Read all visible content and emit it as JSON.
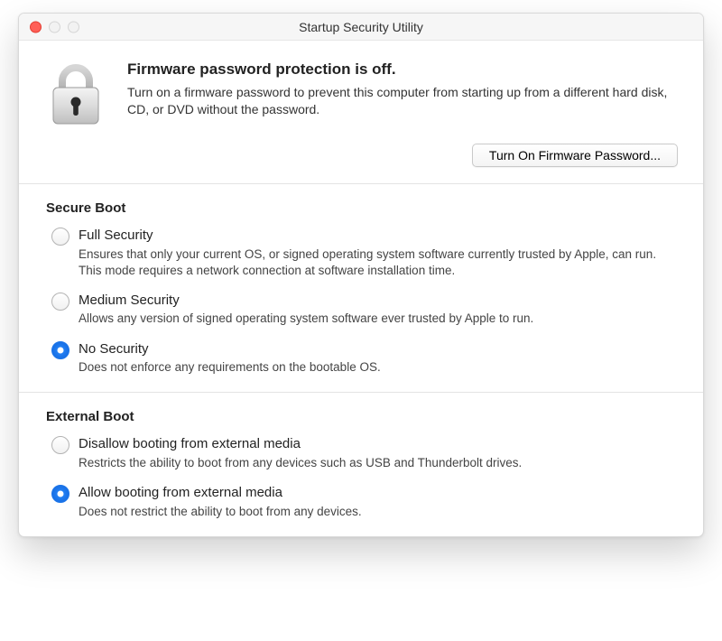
{
  "window": {
    "title": "Startup Security Utility"
  },
  "firmware": {
    "heading": "Firmware password protection is off.",
    "description": "Turn on a firmware password to prevent this computer from starting up from a different hard disk, CD, or DVD without the password.",
    "button_label": "Turn On Firmware Password..."
  },
  "secure_boot": {
    "heading": "Secure Boot",
    "options": [
      {
        "label": "Full Security",
        "description": "Ensures that only your current OS, or signed operating system software currently trusted by Apple, can run. This mode requires a network connection at software installation time.",
        "selected": false
      },
      {
        "label": "Medium Security",
        "description": "Allows any version of signed operating system software ever trusted by Apple to run.",
        "selected": false
      },
      {
        "label": "No Security",
        "description": "Does not enforce any requirements on the bootable OS.",
        "selected": true
      }
    ]
  },
  "external_boot": {
    "heading": "External Boot",
    "options": [
      {
        "label": "Disallow booting from external media",
        "description": "Restricts the ability to boot from any devices such as USB and Thunderbolt drives.",
        "selected": false
      },
      {
        "label": "Allow booting from external media",
        "description": "Does not restrict the ability to boot from any devices.",
        "selected": true
      }
    ]
  }
}
